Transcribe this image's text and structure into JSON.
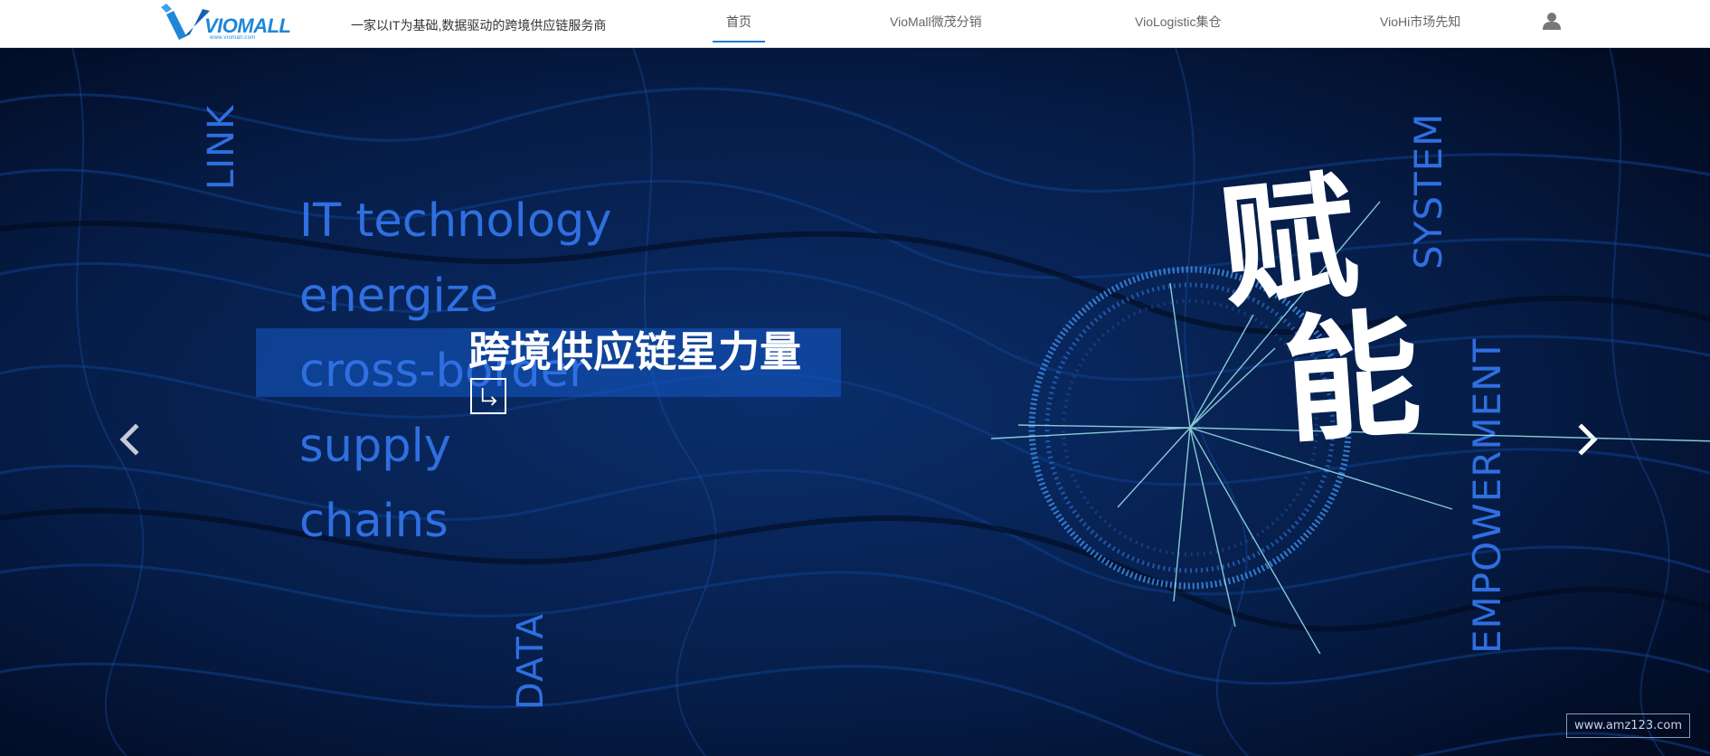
{
  "header": {
    "logo_text": "VIOMALL",
    "logo_sub": "www.viomall.com",
    "tagline": "一家以IT为基础,数据驱动的跨境供应链服务商",
    "nav": [
      {
        "label": "首页",
        "active": true
      },
      {
        "label": "VioMall微茂分销",
        "active": false
      },
      {
        "label": "VioLogistic集仓",
        "active": false
      },
      {
        "label": "VioHi市场先知",
        "active": false
      }
    ],
    "user_icon": "user-icon"
  },
  "hero": {
    "vertical_words": {
      "link": "LINK",
      "data": "DATA",
      "system": "SYSTEM",
      "empowerment": "EMPOWERMENT"
    },
    "lines": [
      "IT technology",
      "energize",
      "cross-border",
      "supply",
      "chains"
    ],
    "cn_title": "跨境供应链星力量",
    "enter_icon": "enter-arrow-icon",
    "calligraphy": [
      "赋",
      "能"
    ],
    "prev_icon": "chevron-left-icon",
    "next_icon": "chevron-right-icon",
    "watermark": "www.amz123.com",
    "colors": {
      "accent_blue": "#2f6fe0",
      "background": "#041535",
      "band": "#1b5cc4",
      "nav_underline": "#1f7ad8"
    }
  }
}
